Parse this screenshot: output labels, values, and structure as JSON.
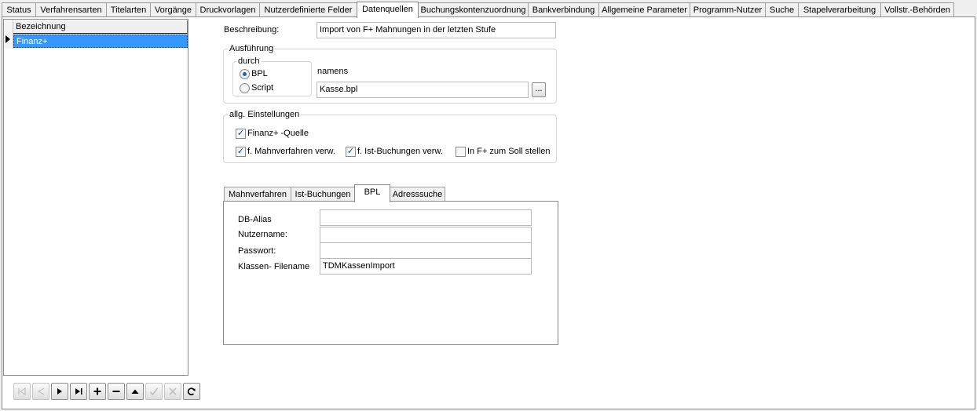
{
  "tabs": [
    {
      "label": "Status"
    },
    {
      "label": "Verfahrensarten"
    },
    {
      "label": "Titelarten"
    },
    {
      "label": "Vorgänge"
    },
    {
      "label": "Druckvorlagen"
    },
    {
      "label": "Nutzerdefinierte Felder"
    },
    {
      "label": "Datenquellen",
      "active": true
    },
    {
      "label": "Buchungskontenzuordnung"
    },
    {
      "label": "Bankverbindung"
    },
    {
      "label": "Allgemeine Parameter"
    },
    {
      "label": "Programm-Nutzer"
    },
    {
      "label": "Suche"
    },
    {
      "label": "Stapelverarbeitung"
    },
    {
      "label": "Vollstr.-Behörden"
    }
  ],
  "grid": {
    "column": "Bezeichnung",
    "rows": [
      "Finanz+"
    ]
  },
  "navigator": {
    "buttons": [
      "first",
      "prior",
      "next",
      "last",
      "insert",
      "delete",
      "edit",
      "post",
      "cancel",
      "refresh"
    ]
  },
  "form": {
    "beschreibung_label": "Beschreibung:",
    "beschreibung_value": "Import von F+ Mahnungen in der letzten Stufe",
    "ausfuehrung_title": "Ausführung",
    "durch_title": "durch",
    "radio_bpl": "BPL",
    "radio_script": "Script",
    "selected_radio": "BPL",
    "namens_label": "namens",
    "namens_value": "Kasse.bpl",
    "browse_label": "...",
    "allg_title": "allg. Einstellungen",
    "check_finanz_quelle": "Finanz+ -Quelle",
    "check_mahnverfahren": "f. Mahnverfahren verw.",
    "check_istbuchungen": "f. Ist-Buchungen verw.",
    "check_soll": "In F+ zum Soll stellen",
    "check_states": {
      "finanz_quelle": true,
      "mahnverfahren": true,
      "istbuchungen": true,
      "soll": false
    }
  },
  "inner_tabs": [
    {
      "label": "Mahnverfahren"
    },
    {
      "label": "Ist-Buchungen"
    },
    {
      "label": "BPL",
      "active": true
    },
    {
      "label": "Adresssuche"
    }
  ],
  "bpl": {
    "db_alias_label": "DB-Alias",
    "db_alias_value": "",
    "nutzername_label": "Nutzername:",
    "nutzername_value": "",
    "passwort_label": "Passwort:",
    "passwort_value": "",
    "klassen_label": "Klassen- Filename",
    "klassen_value": "TDMKassenImport"
  }
}
